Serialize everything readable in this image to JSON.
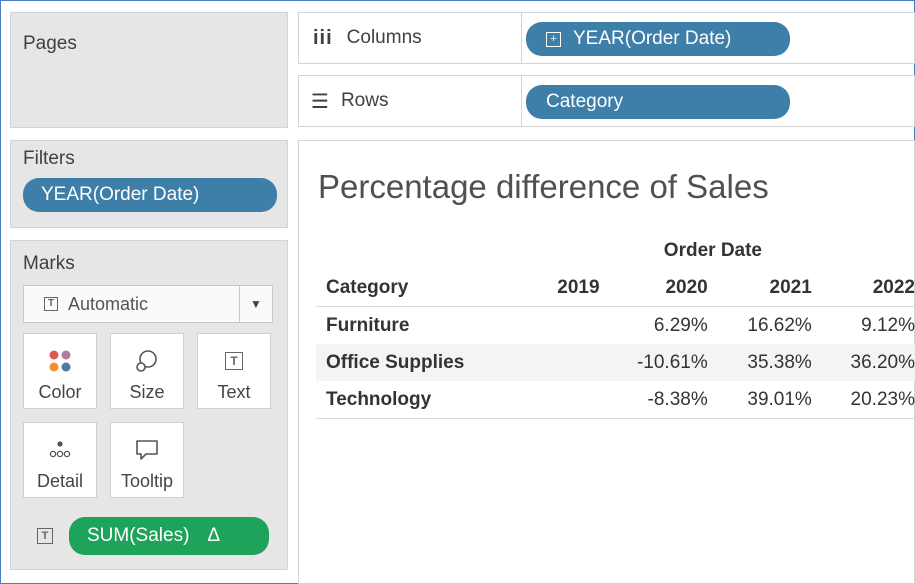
{
  "colors": {
    "blue_pill": "#3d7fa8",
    "green_pill": "#1fa35a",
    "frame_border": "#4a7bc8"
  },
  "pages": {
    "title": "Pages"
  },
  "filters": {
    "title": "Filters",
    "pill": "YEAR(Order Date)"
  },
  "marks": {
    "title": "Marks",
    "type": "Automatic",
    "buttons": [
      {
        "label": "Color",
        "icon": "color-dots-icon"
      },
      {
        "label": "Size",
        "icon": "size-icon"
      },
      {
        "label": "Text",
        "icon": "text-icon"
      },
      {
        "label": "Detail",
        "icon": "detail-icon"
      },
      {
        "label": "Tooltip",
        "icon": "tooltip-icon"
      }
    ],
    "field": {
      "label": "SUM(Sales)",
      "delta": "Δ"
    }
  },
  "columns": {
    "label": "Columns",
    "pill": "YEAR(Order Date)"
  },
  "rows": {
    "label": "Rows",
    "pill": "Category"
  },
  "view": {
    "title": "Percentage difference of Sales",
    "column_group": "Order Date",
    "row_header": "Category",
    "years": [
      "2019",
      "2020",
      "2021",
      "2022"
    ],
    "rows": [
      {
        "category": "Furniture",
        "values": [
          "",
          "6.29%",
          "16.62%",
          "9.12%"
        ]
      },
      {
        "category": "Office Supplies",
        "values": [
          "",
          "-10.61%",
          "35.38%",
          "36.20%"
        ]
      },
      {
        "category": "Technology",
        "values": [
          "",
          "-8.38%",
          "39.01%",
          "20.23%"
        ]
      }
    ]
  }
}
